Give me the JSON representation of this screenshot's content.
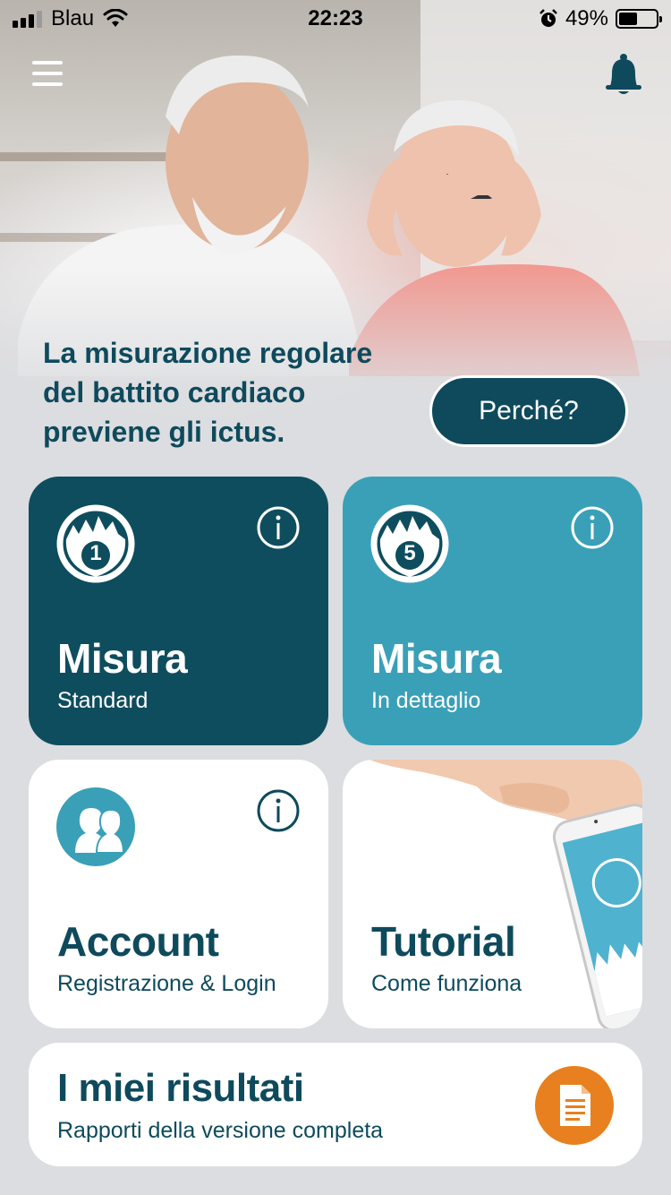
{
  "status_bar": {
    "carrier": "Blau",
    "time": "22:23",
    "battery": "49%",
    "battery_level": 0.49,
    "icons": [
      "signal-icon",
      "wifi-icon",
      "alarm-icon",
      "battery-icon"
    ]
  },
  "header": {
    "menu_icon": "menu-icon",
    "notification_icon": "bell-icon"
  },
  "hero": {
    "headline": "La misurazione regolare del battito cardiaco previene gli ictus.",
    "why_button": "Perché?"
  },
  "tiles": {
    "standard": {
      "badge": "1",
      "title": "Misura",
      "subtitle": "Standard",
      "color": "#0e4d5e"
    },
    "detail": {
      "badge": "5",
      "title": "Misura",
      "subtitle": "In dettaglio",
      "color": "#3aa0b8"
    },
    "account": {
      "title": "Account",
      "subtitle": "Registrazione & Login"
    },
    "tutorial": {
      "title": "Tutorial",
      "subtitle": "Come funziona"
    },
    "results": {
      "title": "I miei risultati",
      "subtitle": "Rapporti della versione completa",
      "button_color": "#e8801f"
    }
  },
  "colors": {
    "primary": "#0e4a5c",
    "accent_light": "#3aa0b8",
    "accent_orange": "#e8801f",
    "background": "#dcdde0"
  }
}
